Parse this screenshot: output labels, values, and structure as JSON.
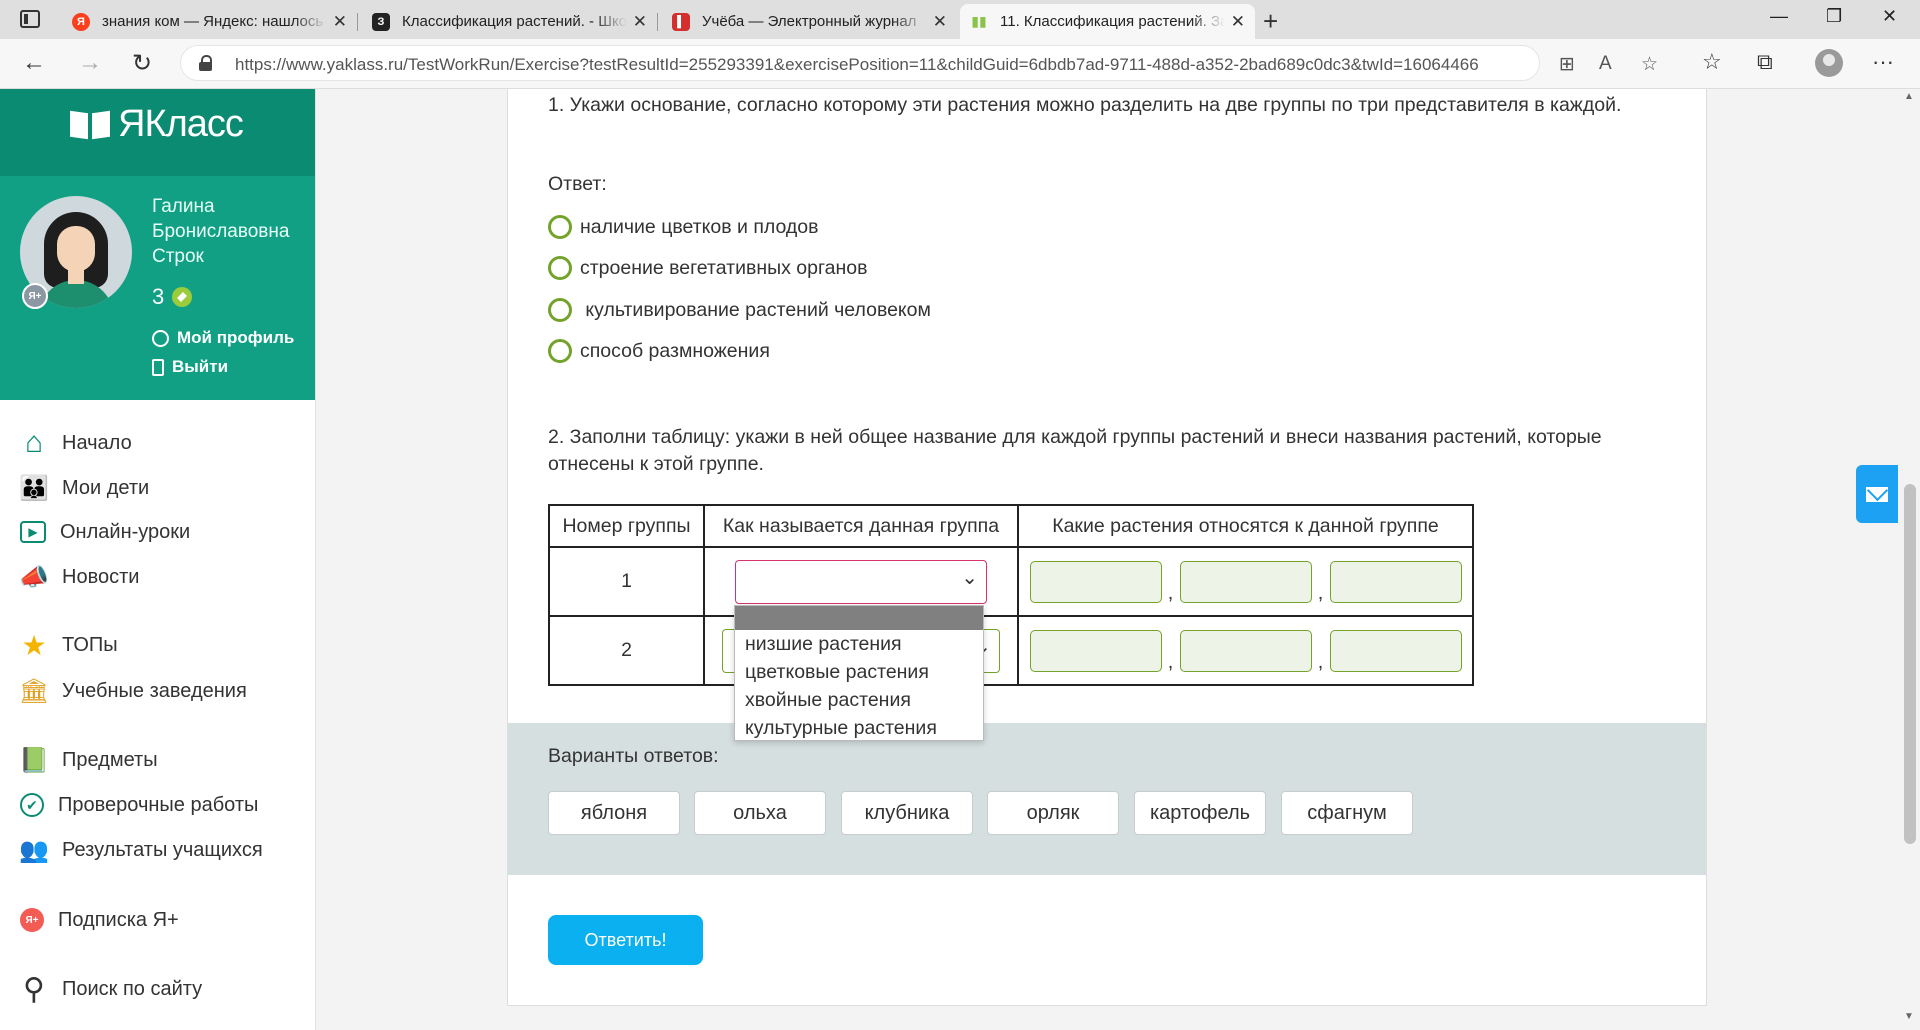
{
  "browser": {
    "tabs": [
      {
        "title": "знания ком — Яндекс: нашлось",
        "favicon": "yandex-icon",
        "favicon_color": "#fc3f1d",
        "favicon_text": "Я"
      },
      {
        "title": "Классификация растений. - Шко",
        "favicon": "school-icon",
        "favicon_color": "#222222",
        "favicon_text": "З"
      },
      {
        "title": "Учёба — Электронный журнал",
        "favicon": "journal-icon",
        "favicon_color": "#d32f2f",
        "favicon_text": "▌"
      },
      {
        "title": "11. Классификация растений. Зад",
        "favicon": "yaklass-icon",
        "favicon_color": "#8bc34a",
        "favicon_text": "▮▮"
      }
    ],
    "new_tab": "+",
    "url": "https://www.yaklass.ru/TestWorkRun/Exercise?testResultId=255293391&exercisePosition=11&childGuid=6dbdb7ad-9711-488d-a352-2bad689c0dc3&twId=16064466"
  },
  "sidebar": {
    "logo": "ЯКласс",
    "user": {
      "name_line1": "Галина",
      "name_line2": "Брониславовна",
      "name_line3": "Строк",
      "points": "3",
      "badge": "Я+",
      "profile_link": "Мой профиль",
      "logout_link": "Выйти"
    },
    "nav": [
      {
        "label": "Начало",
        "icon": "home-icon",
        "glyph": "⌂"
      },
      {
        "label": "Мои дети",
        "icon": "children-icon",
        "glyph": "👪"
      },
      {
        "label": "Онлайн-уроки",
        "icon": "video-lesson-icon",
        "glyph": "▶"
      },
      {
        "label": "Новости",
        "icon": "news-icon",
        "glyph": "📣"
      },
      {
        "label": "ТОПы",
        "icon": "star-icon",
        "glyph": "★"
      },
      {
        "label": "Учебные заведения",
        "icon": "school-building-icon",
        "glyph": "🏛"
      },
      {
        "label": "Предметы",
        "icon": "subjects-icon",
        "glyph": "📗"
      },
      {
        "label": "Проверочные работы",
        "icon": "check-circle-icon",
        "glyph": "✔"
      },
      {
        "label": "Результаты учащихся",
        "icon": "students-icon",
        "glyph": "👥"
      },
      {
        "label": "Подписка Я+",
        "icon": "subscription-icon",
        "glyph": "Я+"
      },
      {
        "label": "Поиск по сайту",
        "icon": "search-icon",
        "glyph": "⚲"
      }
    ]
  },
  "exercise": {
    "q1": "1. Укажи основание, согласно которому эти растения можно разделить на две группы по три представителя в каждой.",
    "answer_label": "Ответ:",
    "options": [
      "наличие цветков и плодов",
      "строение вегетативных органов",
      " культивирование растений человеком",
      "способ размножения"
    ],
    "q2": "2. Заполни таблицу: укажи в ней общее название для каждой группы растений и внеси названия растений, которые отнесены к этой группе.",
    "table": {
      "headers": [
        "Номер группы",
        "Как называется данная группа",
        "Какие растения относятся к данной группе"
      ],
      "rows": [
        "1",
        "2"
      ],
      "comma": ","
    },
    "dropdown_options": [
      "низшие растения",
      "цветковые растения",
      "хвойные растения",
      "культурные растения"
    ],
    "variants_label": "Варианты ответов:",
    "variants": [
      "яблоня",
      "ольха",
      "клубника",
      "орляк",
      "картофель",
      "сфагнум"
    ],
    "submit": "Ответить!"
  }
}
